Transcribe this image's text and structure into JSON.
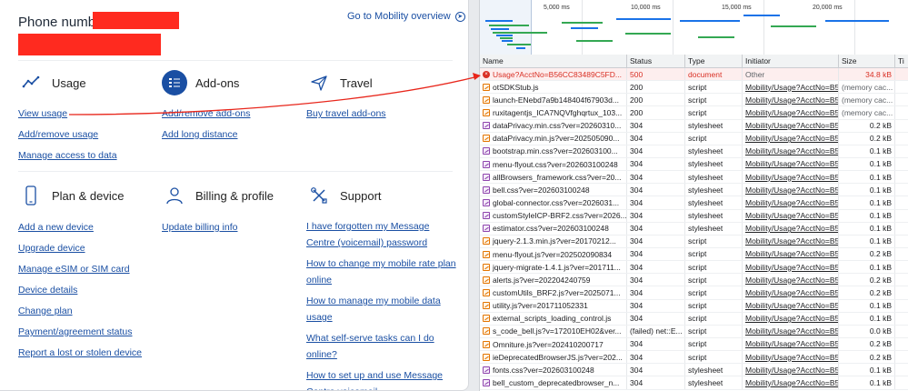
{
  "account": {
    "phone_label": "Phone number:",
    "mobility_link": "Go to Mobility overview"
  },
  "sections": {
    "usage": {
      "title": "Usage",
      "links": [
        "View usage",
        "Add/remove usage",
        "Manage access to data"
      ]
    },
    "addons": {
      "title": "Add-ons",
      "links": [
        "Add/remove add-ons",
        "Add long distance"
      ]
    },
    "travel": {
      "title": "Travel",
      "links": [
        "Buy travel add-ons"
      ]
    },
    "plan_device": {
      "title": "Plan & device",
      "links": [
        "Add a new device",
        "Upgrade device",
        "Manage eSIM or SIM card",
        "Device details",
        "Change plan",
        "Payment/agreement status",
        "Report a lost or stolen device"
      ]
    },
    "billing": {
      "title": "Billing & profile",
      "links": [
        "Update billing info"
      ]
    },
    "support": {
      "title": "Support",
      "links": [
        "I have forgotten my Message Centre (voicemail) password",
        "How to change my mobile rate plan online",
        "How to manage my mobile data usage",
        "What self-serve tasks can I do online?",
        "How to set up and use Message Centre voicemail"
      ]
    }
  },
  "devtools": {
    "timeline_ticks": [
      "5,000 ms",
      "10,000 ms",
      "15,000 ms",
      "20,000 ms"
    ],
    "columns": [
      "Name",
      "Status",
      "Type",
      "Initiator",
      "Size",
      "Ti"
    ],
    "rows": [
      {
        "name": "Usage?AcctNo=B56CC83489C5FD...",
        "status": "500",
        "type": "document",
        "initiator": "Other",
        "size": "34.8 kB",
        "error": true
      },
      {
        "name": "otSDKStub.js",
        "status": "200",
        "type": "script",
        "initiator": "Mobility/Usage?AcctNo=B5...",
        "size": "(memory cac..."
      },
      {
        "name": "launch-ENebd7a9b148404f67903d...",
        "status": "200",
        "type": "script",
        "initiator": "Mobility/Usage?AcctNo=B5...",
        "size": "(memory cac..."
      },
      {
        "name": "ruxitagentjs_ICA7NQVfghqrtux_103...",
        "status": "200",
        "type": "script",
        "initiator": "Mobility/Usage?AcctNo=B5...",
        "size": "(memory cac..."
      },
      {
        "name": "dataPrivacy.min.css?ver=20260310...",
        "status": "304",
        "type": "stylesheet",
        "initiator": "Mobility/Usage?AcctNo=B5...",
        "size": "0.2 kB"
      },
      {
        "name": "dataPrivacy.min.js?ver=202505090...",
        "status": "304",
        "type": "script",
        "initiator": "Mobility/Usage?AcctNo=B5...",
        "size": "0.2 kB"
      },
      {
        "name": "bootstrap.min.css?ver=202603100...",
        "status": "304",
        "type": "stylesheet",
        "initiator": "Mobility/Usage?AcctNo=B5...",
        "size": "0.1 kB"
      },
      {
        "name": "menu-flyout.css?ver=202603100248",
        "status": "304",
        "type": "stylesheet",
        "initiator": "Mobility/Usage?AcctNo=B5...",
        "size": "0.1 kB"
      },
      {
        "name": "allBrowsers_framework.css?ver=20...",
        "status": "304",
        "type": "stylesheet",
        "initiator": "Mobility/Usage?AcctNo=B5...",
        "size": "0.1 kB"
      },
      {
        "name": "bell.css?ver=202603100248",
        "status": "304",
        "type": "stylesheet",
        "initiator": "Mobility/Usage?AcctNo=B5...",
        "size": "0.1 kB"
      },
      {
        "name": "global-connector.css?ver=2026031...",
        "status": "304",
        "type": "stylesheet",
        "initiator": "Mobility/Usage?AcctNo=B5...",
        "size": "0.1 kB"
      },
      {
        "name": "customStyleICP-BRF2.css?ver=2026...",
        "status": "304",
        "type": "stylesheet",
        "initiator": "Mobility/Usage?AcctNo=B5...",
        "size": "0.1 kB"
      },
      {
        "name": "estimator.css?ver=202603100248",
        "status": "304",
        "type": "stylesheet",
        "initiator": "Mobility/Usage?AcctNo=B5...",
        "size": "0.1 kB"
      },
      {
        "name": "jquery-2.1.3.min.js?ver=20170212...",
        "status": "304",
        "type": "script",
        "initiator": "Mobility/Usage?AcctNo=B5...",
        "size": "0.1 kB"
      },
      {
        "name": "menu-flyout.js?ver=202502090834",
        "status": "304",
        "type": "script",
        "initiator": "Mobility/Usage?AcctNo=B5...",
        "size": "0.2 kB"
      },
      {
        "name": "jquery-migrate-1.4.1.js?ver=201711...",
        "status": "304",
        "type": "script",
        "initiator": "Mobility/Usage?AcctNo=B5...",
        "size": "0.1 kB"
      },
      {
        "name": "alerts.js?ver=202204240759",
        "status": "304",
        "type": "script",
        "initiator": "Mobility/Usage?AcctNo=B5...",
        "size": "0.2 kB"
      },
      {
        "name": "customUtils_BRF2.js?ver=2025071...",
        "status": "304",
        "type": "script",
        "initiator": "Mobility/Usage?AcctNo=B5...",
        "size": "0.2 kB"
      },
      {
        "name": "utility.js?ver=201711052331",
        "status": "304",
        "type": "script",
        "initiator": "Mobility/Usage?AcctNo=B5...",
        "size": "0.1 kB"
      },
      {
        "name": "external_scripts_loading_control.js",
        "status": "304",
        "type": "script",
        "initiator": "Mobility/Usage?AcctNo=B5...",
        "size": "0.1 kB"
      },
      {
        "name": "s_code_bell.js?v=172010EH02&ver...",
        "status": "(failed) net::E...",
        "type": "script",
        "initiator": "Mobility/Usage?AcctNo=B5...",
        "size": "0.0 kB"
      },
      {
        "name": "Omniture.js?ver=202410200717",
        "status": "304",
        "type": "script",
        "initiator": "Mobility/Usage?AcctNo=B5...",
        "size": "0.2 kB"
      },
      {
        "name": "ieDeprecatedBrowserJS.js?ver=202...",
        "status": "304",
        "type": "script",
        "initiator": "Mobility/Usage?AcctNo=B5...",
        "size": "0.2 kB"
      },
      {
        "name": "fonts.css?ver=202603100248",
        "status": "304",
        "type": "stylesheet",
        "initiator": "Mobility/Usage?AcctNo=B5...",
        "size": "0.1 kB"
      },
      {
        "name": "bell_custom_deprecatedbrowser_n...",
        "status": "304",
        "type": "stylesheet",
        "initiator": "Mobility/Usage?AcctNo=B5...",
        "size": "0.1 kB"
      }
    ]
  },
  "colors": {
    "link": "#1a4fa3",
    "redaction": "#ff2a1f",
    "error": "#d93025",
    "annotation_arrow": "#e8261b"
  },
  "icons": [
    "trend-line-icon",
    "addons-list-icon",
    "paper-plane-icon",
    "phone-icon",
    "person-icon",
    "tools-icon",
    "arrow-right-circle-icon",
    "script-file-icon",
    "stylesheet-file-icon",
    "error-icon"
  ]
}
